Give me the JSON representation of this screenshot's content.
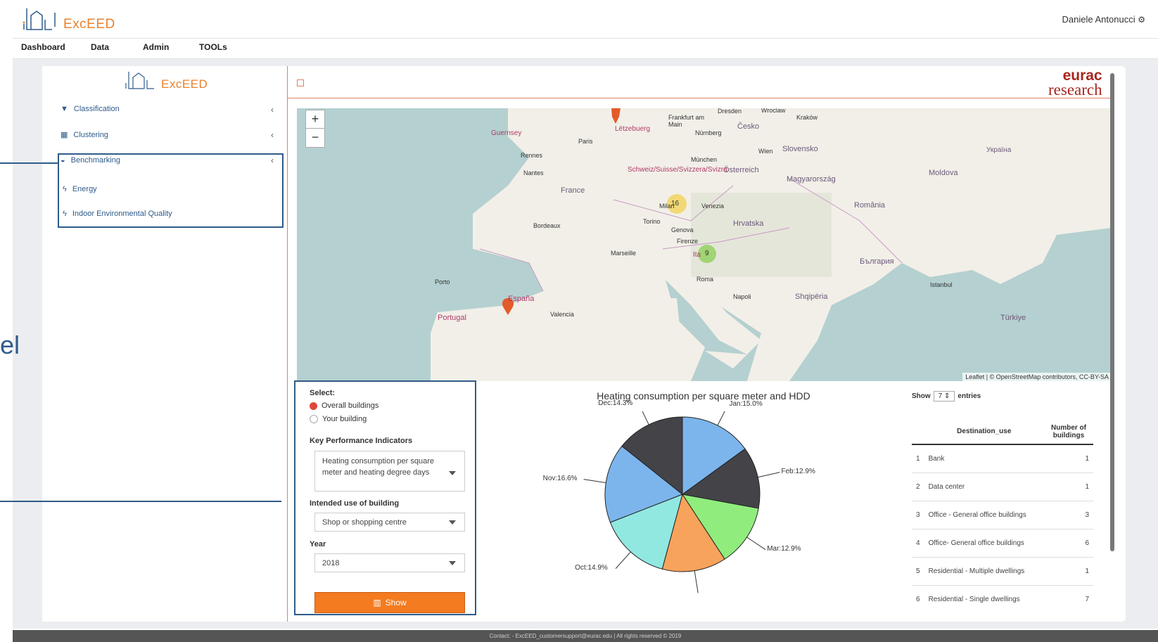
{
  "app": {
    "logo_text": "ExcEED",
    "user_name": "Daniele Antonucci"
  },
  "nav": {
    "items": [
      "Dashboard",
      "Data",
      "Admin",
      "TOOLs"
    ]
  },
  "sidebar": {
    "logo_text": "ExcEED",
    "items": [
      {
        "label": "Classification",
        "icon": "filter-icon"
      },
      {
        "label": "Clustering",
        "icon": "grid-icon"
      },
      {
        "label": "Benchmarking",
        "icon": "dashboard-icon"
      },
      {
        "label": "Energy",
        "icon": "bolt-icon"
      },
      {
        "label": "Indoor Environmental Quality",
        "icon": "bolt-icon"
      }
    ]
  },
  "side_text": "el",
  "header": {
    "brand_top": "eurac",
    "brand_bottom": "research"
  },
  "map": {
    "zoom_in": "+",
    "zoom_out": "−",
    "clusters": [
      "16",
      "9"
    ],
    "attribution": "Leaflet | © OpenStreetMap contributors, CC-BY-SA",
    "labels": {
      "france": "France",
      "espana": "España",
      "portugal": "Portugal",
      "italia": "Ita",
      "roma": "Roma",
      "marseille": "Marseille",
      "napoli": "Napoli",
      "bordeaux": "Bordeaux",
      "paris": "Paris",
      "cesko": "Česko",
      "osterreich": "Österreich",
      "slovensko": "Slovensko",
      "magyarorszag": "Magyarország",
      "romania": "România",
      "hrvatska": "Hrvatska",
      "istanbul": "Istanbul",
      "turkiye": "Türkiye",
      "shqiperia": "Shqipëria",
      "moldova": "Moldova",
      "ukraina": "Україна",
      "bulgaria": "България",
      "luxembourg": "Lëtzebuerg",
      "schweiz": "Schweiz/Suisse/Svizzera/Svizra",
      "milano": "Milan",
      "venezia": "Venezia",
      "genova": "Genova",
      "torino": "Torino",
      "firenze": "Firenze",
      "valencia": "Valencia",
      "porto": "Porto",
      "munchen": "München",
      "wien": "Wien",
      "nurnberg": "Nürnberg",
      "frankfurt": "Frankfurt am Main",
      "dresden": "Dresden",
      "wroclaw": "Wroclaw",
      "krakow": "Kraków",
      "nantes": "Nantes",
      "rennes": "Rennes",
      "guernsey": "Guernsey"
    }
  },
  "form": {
    "select_label": "Select:",
    "radio_overall": "Overall buildings",
    "radio_your": "Your building",
    "kpi_label": "Key Performance Indicators",
    "kpi_value": "Heating consumption per square meter and heating degree days",
    "use_label": "Intended use of building",
    "use_value": "Shop or shopping centre",
    "year_label": "Year",
    "year_value": "2018",
    "show_button": "Show"
  },
  "chart_data": {
    "type": "pie",
    "title": "Heating consumption per square meter and HDD",
    "slices": [
      {
        "label": "Jan",
        "value": 15.0,
        "display": "Jan:15.0%",
        "color": "#7cb5ec"
      },
      {
        "label": "Feb",
        "value": 12.9,
        "display": "Feb:12.9%",
        "color": "#434348"
      },
      {
        "label": "Mar",
        "value": 12.9,
        "display": "Mar:12.9%",
        "color": "#90ed7d"
      },
      {
        "label": "",
        "value": 13.4,
        "display": "",
        "color": "#f7a35c"
      },
      {
        "label": "Oct",
        "value": 14.9,
        "display": "Oct:14.9%",
        "color": "#91e8e1"
      },
      {
        "label": "Nov",
        "value": 16.6,
        "display": "Nov:16.6%",
        "color": "#7cb5ec"
      },
      {
        "label": "Dec",
        "value": 14.3,
        "display": "Dec:14.3%",
        "color": "#434348"
      }
    ]
  },
  "table": {
    "show_label": "Show",
    "entries_label": "entries",
    "page_size": "7",
    "columns": [
      "",
      "Destination_use",
      "Number of buildings"
    ],
    "rows": [
      [
        "1",
        "Bank",
        "1"
      ],
      [
        "2",
        "Data center",
        "1"
      ],
      [
        "3",
        "Office - General office buildings",
        "3"
      ],
      [
        "4",
        "Office- General office buildings",
        "6"
      ],
      [
        "5",
        "Residential - Multiple dwellings",
        "1"
      ],
      [
        "6",
        "Residential - Single dwellings",
        "7"
      ]
    ]
  },
  "footer": {
    "text": "Contact: - ExcEED_customersupport@eurac.edu | All rights reserved © 2019"
  },
  "colors": {
    "accent": "#f47b20",
    "highlight": "#2f5c8a",
    "link": "#2d5a8a"
  }
}
